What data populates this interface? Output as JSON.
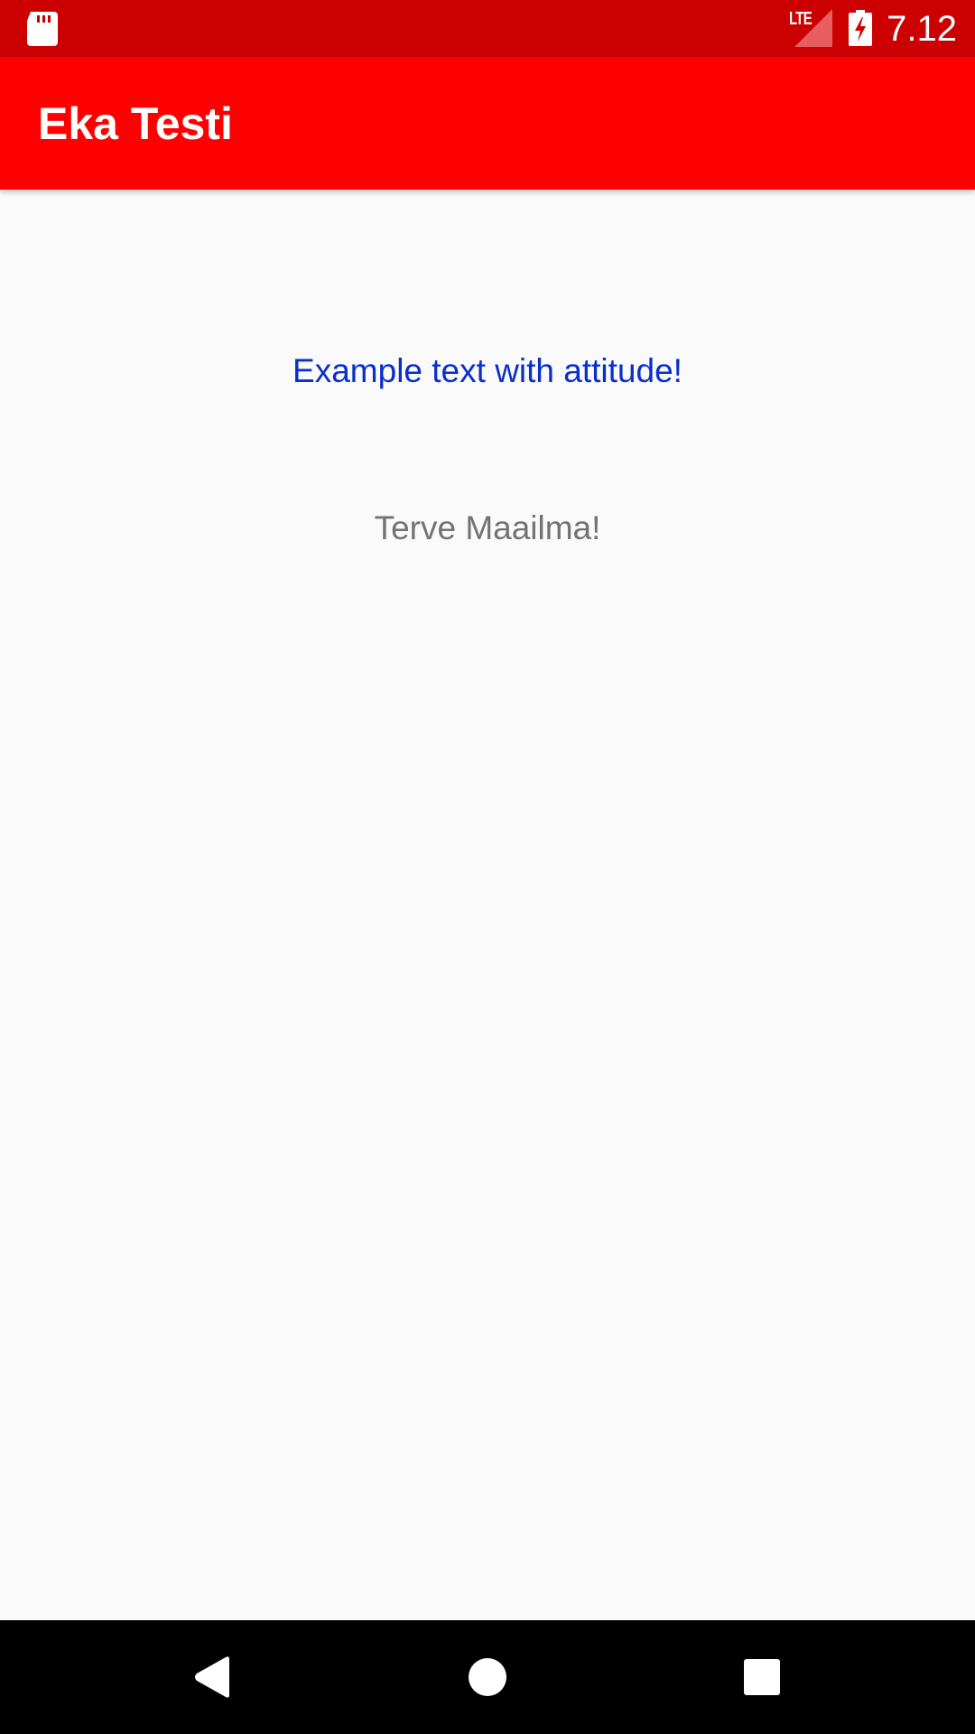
{
  "status_bar": {
    "network_label": "LTE",
    "time": "7.12",
    "icons": [
      "sd-card-icon",
      "cell-signal-icon",
      "battery-charging-icon"
    ]
  },
  "app_bar": {
    "title": "Eka Testi"
  },
  "content": {
    "attitude_text": "Example text with attitude!",
    "hello_text": "Terve Maailma!"
  },
  "nav_bar": {
    "icons": [
      "back-icon",
      "home-icon",
      "recents-icon"
    ]
  },
  "colors": {
    "status_bar": "#cc0000",
    "app_bar": "#ff0000",
    "background": "#fafafa",
    "attitude_text": "#0a2fcc",
    "hello_text": "#737373",
    "nav_bar": "#000000"
  }
}
